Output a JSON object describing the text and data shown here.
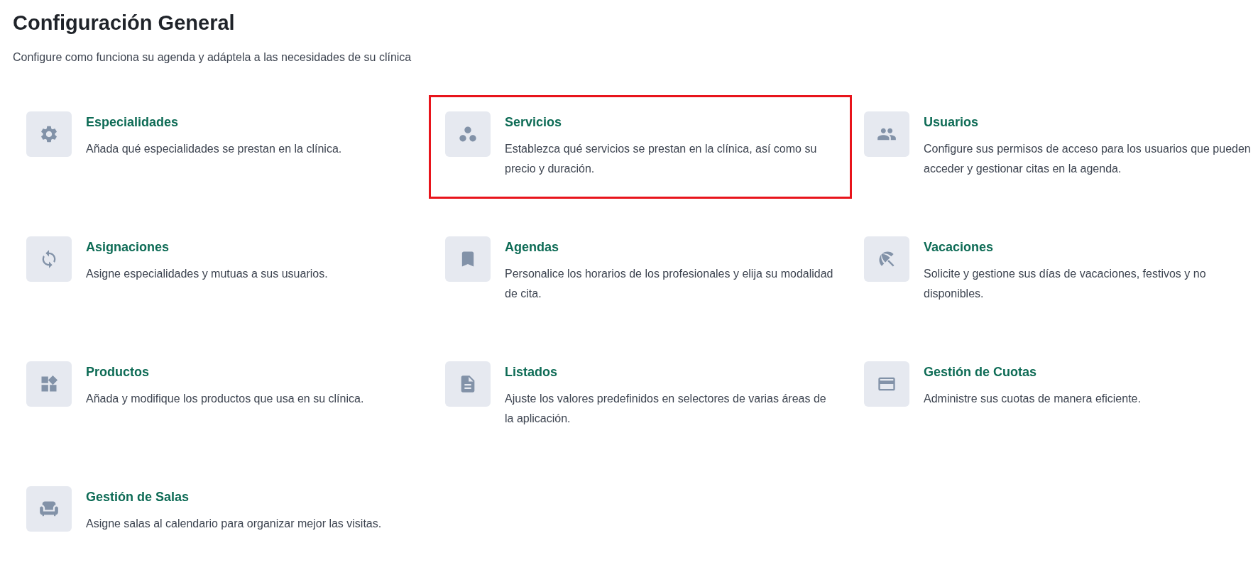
{
  "header": {
    "title": "Configuración General",
    "subtitle": "Configure como funciona su agenda y adáptela a las necesidades de su clínica"
  },
  "cards": [
    {
      "kind": "gear",
      "title": "Especialidades",
      "description": "Añada qué especialidades se prestan en la clínica.",
      "highlighted": false
    },
    {
      "kind": "dots",
      "title": "Servicios",
      "description": "Establezca qué servicios se prestan en la clínica, así como su precio y duración.",
      "highlighted": true
    },
    {
      "kind": "people",
      "title": "Usuarios",
      "description": "Configure sus permisos de acceso para los usuarios que pueden acceder y gestionar citas en la agenda.",
      "highlighted": false
    },
    {
      "kind": "sync",
      "title": "Asignaciones",
      "description": "Asigne especialidades y mutuas a sus usuarios.",
      "highlighted": false
    },
    {
      "kind": "bookmark",
      "title": "Agendas",
      "description": "Personalice los horarios de los profesionales y elija su modalidad de cita.",
      "highlighted": false
    },
    {
      "kind": "umbrella",
      "title": "Vacaciones",
      "description": "Solicite y gestione sus días de vacaciones, festivos y no disponibles.",
      "highlighted": false
    },
    {
      "kind": "widgets",
      "title": "Productos",
      "description": "Añada y modifique los productos que usa en su clínica.",
      "highlighted": false
    },
    {
      "kind": "document",
      "title": "Listados",
      "description": "Ajuste los valores predefinidos en selectores de varias áreas de la aplicación.",
      "highlighted": false
    },
    {
      "kind": "card",
      "title": "Gestión de Cuotas",
      "description": "Administre sus cuotas de manera eficiente.",
      "highlighted": false
    },
    {
      "kind": "chair",
      "title": "Gestión de Salas",
      "description": "Asigne salas al calendario para organizar mejor las visitas.",
      "highlighted": false
    }
  ]
}
